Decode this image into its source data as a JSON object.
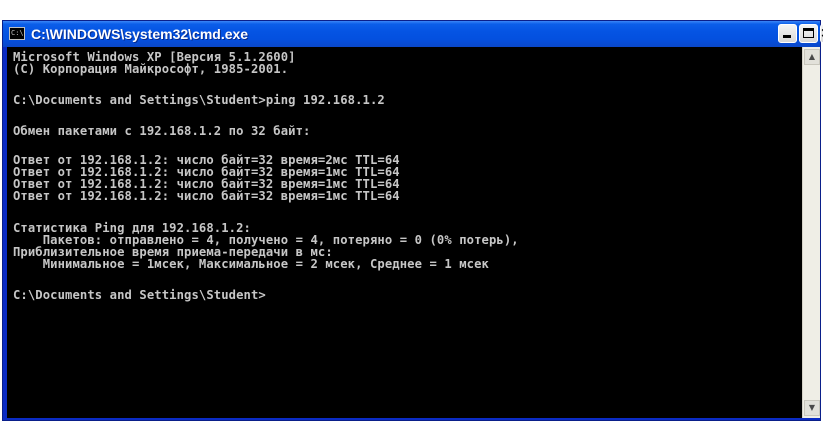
{
  "window": {
    "title": "C:\\WINDOWS\\system32\\cmd.exe",
    "icon_label": "C:\\",
    "minimize_icon": "minimize-icon",
    "maximize_icon": "maximize-icon",
    "close_icon": "close-icon",
    "close_glyph": "×"
  },
  "console": {
    "text_color": "#c6c6c6",
    "background": "#000000",
    "lines": [
      "Microsoft Windows XP [Версия 5.1.2600]",
      "(C) Корпорация Майкрософт, 1985-2001.",
      "",
      "C:\\Documents and Settings\\Student>ping 192.168.1.2",
      "",
      "Обмен пакетами с 192.168.1.2 по 32 байт:",
      "",
      "Ответ от 192.168.1.2: число байт=32 время=2мс TTL=64",
      "Ответ от 192.168.1.2: число байт=32 время=1мс TTL=64",
      "Ответ от 192.168.1.2: число байт=32 время=1мс TTL=64",
      "Ответ от 192.168.1.2: число байт=32 время=1мс TTL=64",
      "",
      "Статистика Ping для 192.168.1.2:",
      "    Пакетов: отправлено = 4, получено = 4, потеряно = 0 (0% потерь),",
      "Приблизительное время приема-передачи в мс:",
      "    Минимальное = 1мсек, Максимальное = 2 мсек, Среднее = 1 мсек",
      "",
      "C:\\Documents and Settings\\Student>"
    ]
  },
  "scrollbar": {
    "up_arrow": "▲",
    "down_arrow": "▼"
  }
}
